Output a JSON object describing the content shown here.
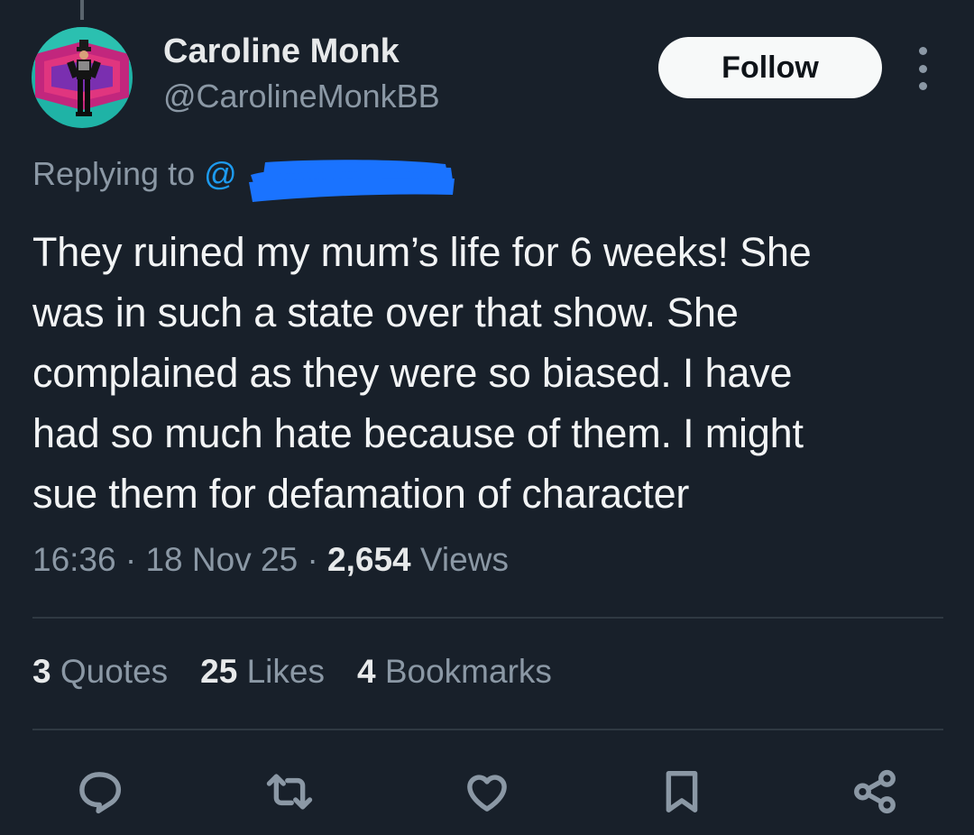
{
  "author": {
    "name": "Caroline Monk",
    "handle": "@CarolineMonkBB",
    "avatar_icon": "avatar-image"
  },
  "follow_label": "Follow",
  "more_icon": "more-options-icon",
  "reply": {
    "prefix": "Replying to",
    "handle_visible": "@"
  },
  "tweet": {
    "lines": [
      "They ruined my mum’s life for 6 weeks! She",
      "was in such a state over that show. She",
      "complained as they were so biased. I have",
      "had so much hate because of them. I might",
      "sue them for defamation of character"
    ],
    "time": "16:36",
    "date": "18 Nov 25",
    "views_count": "2,654",
    "views_label": "Views"
  },
  "stats": {
    "quotes_count": "3",
    "quotes_label": "Quotes",
    "likes_count": "25",
    "likes_label": "Likes",
    "bookmarks_count": "4",
    "bookmarks_label": "Bookmarks"
  },
  "actions": [
    "reply-icon",
    "retweet-icon",
    "like-icon",
    "bookmark-icon",
    "share-icon"
  ],
  "colors": {
    "background": "#18202a",
    "text": "#e7e9ea",
    "muted": "#8b98a5",
    "link": "#1d9bf0",
    "redaction": "#1a73ff"
  }
}
